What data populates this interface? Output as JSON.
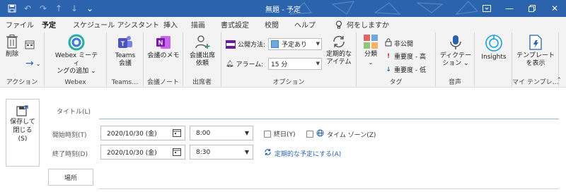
{
  "window": {
    "title": "無題 - 予定",
    "accent": "#2b64ad",
    "quick_access": [
      "save-icon",
      "undo-icon",
      "redo-icon",
      "up-arrow-icon",
      "down-arrow-icon",
      "customize-icon"
    ],
    "controls": [
      "ribbon-display-icon",
      "minimize-icon",
      "restore-icon",
      "close-icon"
    ]
  },
  "tabs": [
    {
      "label": "ファイル"
    },
    {
      "label": "予定",
      "active": true
    },
    {
      "label": "スケジュール アシスタント"
    },
    {
      "label": "挿入"
    },
    {
      "label": "描画"
    },
    {
      "label": "書式設定"
    },
    {
      "label": "校閲"
    },
    {
      "label": "ヘルプ"
    }
  ],
  "tellme": "何をしますか",
  "ribbon": {
    "action": {
      "delete": "削除",
      "group": "アクション"
    },
    "webex": {
      "add_line1": "Webex ミーティ",
      "add_line2": "ングの追加 ⌄",
      "group": "Webex"
    },
    "teams": {
      "btn_line1": "Teams",
      "btn_line2": "会議",
      "group": "Teams…"
    },
    "notes": {
      "btn": "会議のメモ",
      "group": "会議ノート"
    },
    "attendees": {
      "btn_line1": "会議出席",
      "btn_line2": "依頼",
      "group": "出席者"
    },
    "options": {
      "show_as_label": "公開方法:",
      "show_as_value": "予定あり",
      "reminder_label": "アラーム:",
      "reminder_value": "15 分",
      "recurrence_line1": "定期的な",
      "recurrence_line2": "アイテム",
      "group": "オプション"
    },
    "tags": {
      "categorize": "分類",
      "private": "非公開",
      "high": "重要度 - 高",
      "low": "重要度 - 低",
      "group": "タグ"
    },
    "voice": {
      "dictate": "ディクテー",
      "dictate2": "ション ⌄",
      "group": "音声"
    },
    "insights": {
      "btn": "Insights"
    },
    "templates": {
      "btn_line1": "テンプレート",
      "btn_line2": "を表示",
      "group": "マイ テンプレ…"
    }
  },
  "form": {
    "save_close_line1": "保存して",
    "save_close_line2": "閉じる",
    "save_close_line3": "(S)",
    "title_label": "タイトル(L)",
    "start_label": "開始時刻(T)",
    "end_label": "終了時刻(D)",
    "start_date": "2020/10/30 (金)",
    "start_time": "8:00",
    "end_date": "2020/10/30 (金)",
    "end_time": "8:30",
    "all_day": "終日(Y)",
    "timezone": "タイム ゾーン(Z)",
    "recurring_link": "定期的な予定にする(A)",
    "location": "場所"
  }
}
